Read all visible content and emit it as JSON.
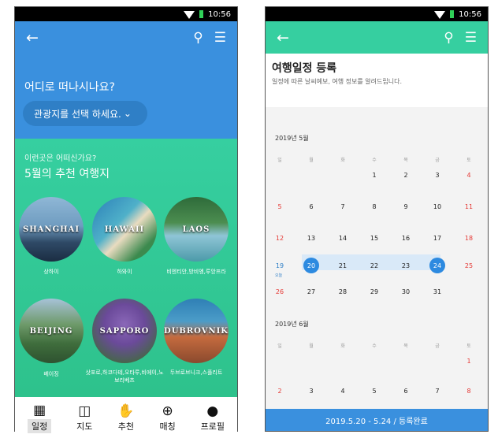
{
  "left": {
    "status": {
      "time": "10:56"
    },
    "hero": {
      "question": "어디로 떠나시나요?",
      "select_label": "관광지를 선택 하세요.",
      "select_chevron": "⌄"
    },
    "recommend": {
      "subtitle": "이런곳은 어떠신가요?",
      "title": "5월의 추천 여행지"
    },
    "cities": [
      {
        "name": "SHANGHAI",
        "caption": "상하이"
      },
      {
        "name": "HAWAII",
        "caption": "하와이"
      },
      {
        "name": "LAOS",
        "caption": "비엔티안,방비엥,루앙프라"
      },
      {
        "name": "BEIJING",
        "caption": "베이징"
      },
      {
        "name": "SAPPORO",
        "caption": "삿포로,하코다테,오타루,비에이,노보리베츠"
      },
      {
        "name": "DUBROVNIK",
        "caption": "두브로브니크,스플리트"
      }
    ],
    "tabs": [
      {
        "label": "일정",
        "icon": "calendar-icon"
      },
      {
        "label": "지도",
        "icon": "map-icon"
      },
      {
        "label": "추천",
        "icon": "thumbs-up-icon"
      },
      {
        "label": "매칭",
        "icon": "globe-icon"
      },
      {
        "label": "프로필",
        "icon": "person-icon"
      }
    ],
    "colors": {
      "appbar": "#3a90de",
      "recommend": "#36cfa0"
    }
  },
  "right": {
    "status": {
      "time": "10:56"
    },
    "register": {
      "title": "여행일정 등록",
      "desc": "일정에 따른 날씨예보, 여행 정보를 알려드립니다."
    },
    "weekdays": [
      "일",
      "월",
      "화",
      "수",
      "목",
      "금",
      "토"
    ],
    "months": [
      {
        "title": "2019년 5월",
        "weeks": [
          [
            "",
            "",
            "",
            "1",
            "2",
            "3",
            "4"
          ],
          [
            "5",
            "6",
            "7",
            "8",
            "9",
            "10",
            "11"
          ],
          [
            "12",
            "13",
            "14",
            "15",
            "16",
            "17",
            "18"
          ],
          [
            "19",
            "20",
            "21",
            "22",
            "23",
            "24",
            "25"
          ],
          [
            "26",
            "27",
            "28",
            "29",
            "30",
            "31",
            ""
          ]
        ],
        "today_label": "오늘"
      },
      {
        "title": "2019년 6월",
        "weeks": [
          [
            "",
            "",
            "",
            "",
            "",
            "",
            "1"
          ],
          [
            "2",
            "3",
            "4",
            "5",
            "6",
            "7",
            "8"
          ]
        ]
      }
    ],
    "selected": [
      "20",
      "24"
    ],
    "footer": "2019.5.20 - 5.24 / 등록완료",
    "colors": {
      "appbar": "#36cfa0",
      "range": "#d9e9f8",
      "selected": "#2d8ae0",
      "holiday": "#e53935"
    }
  }
}
